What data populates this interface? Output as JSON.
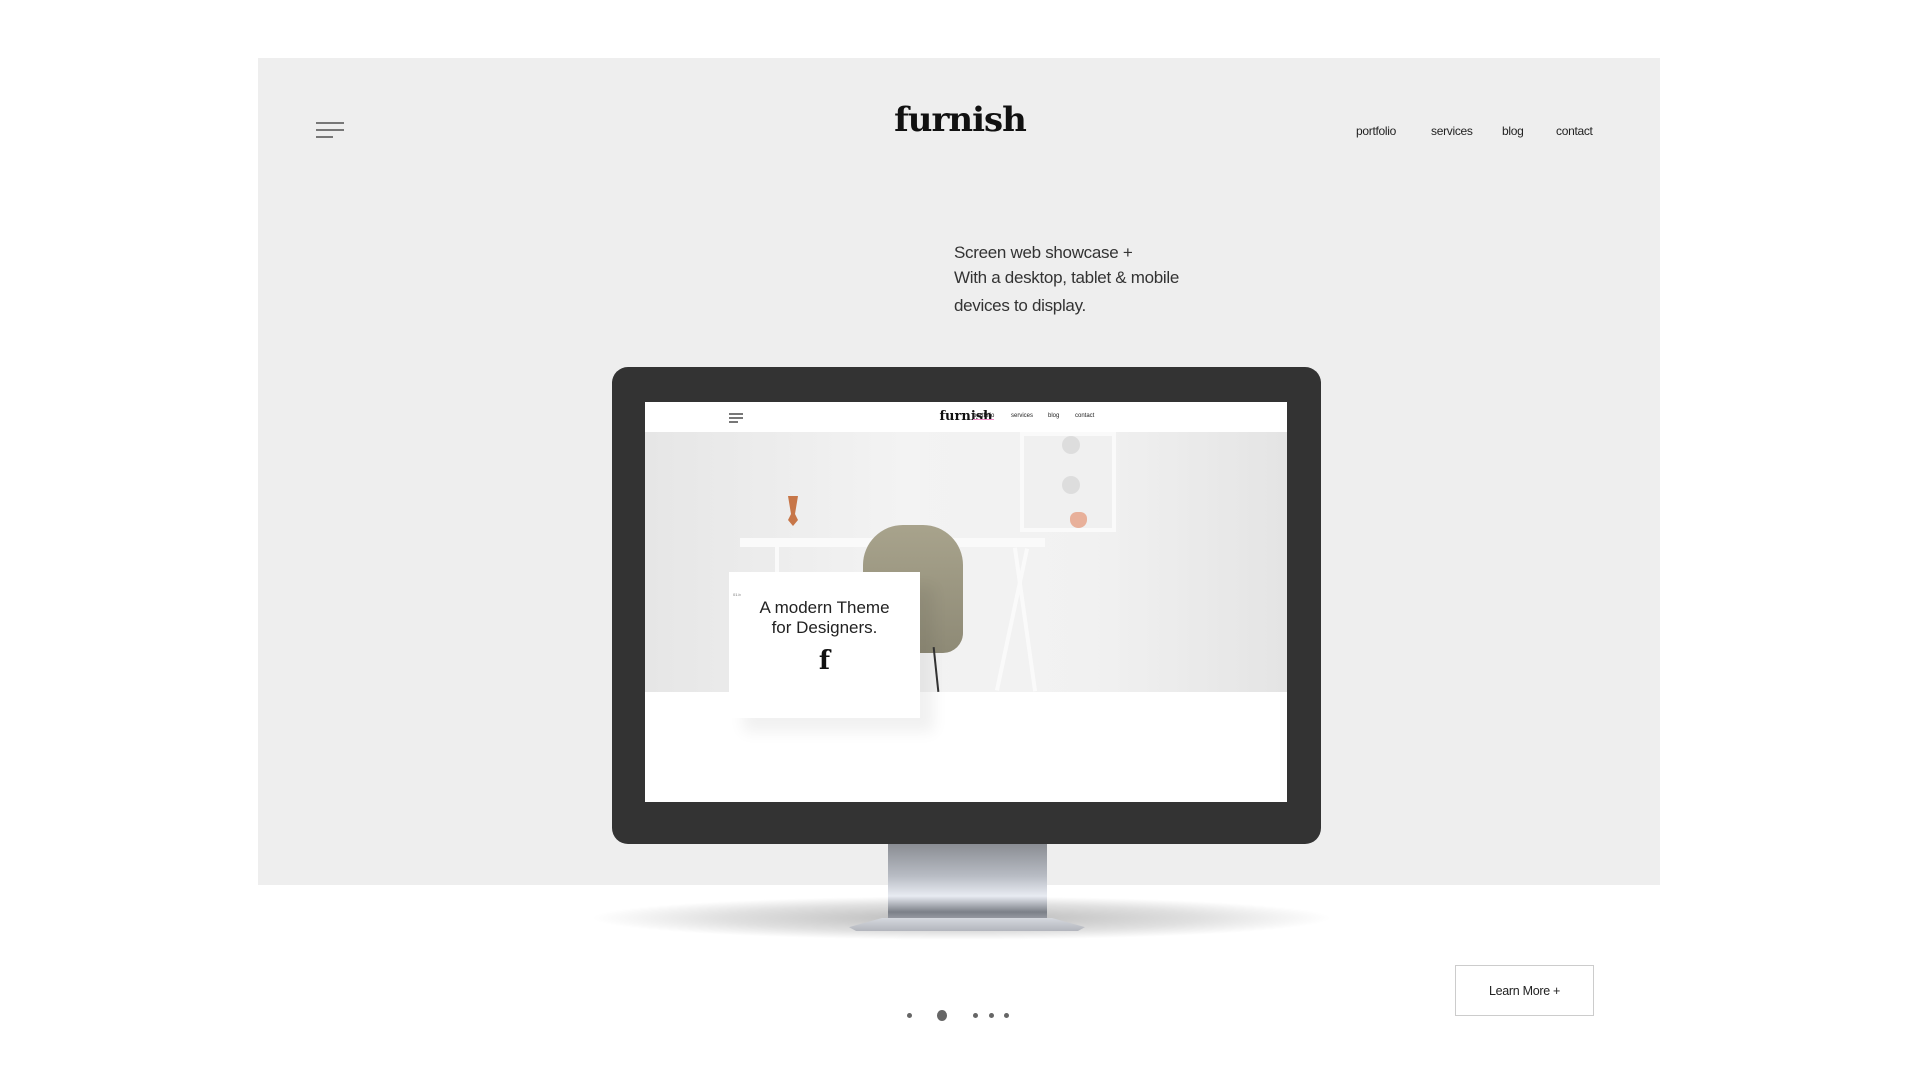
{
  "header": {
    "logo": "furnish",
    "menu_icon": "hamburger-icon",
    "nav": [
      {
        "label": "portfolio"
      },
      {
        "label": "services"
      },
      {
        "label": "blog"
      },
      {
        "label": "contact"
      }
    ]
  },
  "tagline": {
    "lines": [
      "Screen web showcase +",
      "With a desktop, tablet & mobile",
      "devices to display."
    ]
  },
  "mockup": {
    "logo": "furnish",
    "nav": [
      {
        "label": "portfolio",
        "active": true
      },
      {
        "label": "services"
      },
      {
        "label": "blog"
      },
      {
        "label": "contact"
      }
    ],
    "card_title_1": "A modern Theme",
    "card_title_2": "for Designers.",
    "card_mark": "f",
    "card_caption": "01.b",
    "accent": "#f08cc8"
  },
  "cta": {
    "label": "Learn More +"
  },
  "pagination": {
    "count": 5,
    "active_index": 1
  }
}
